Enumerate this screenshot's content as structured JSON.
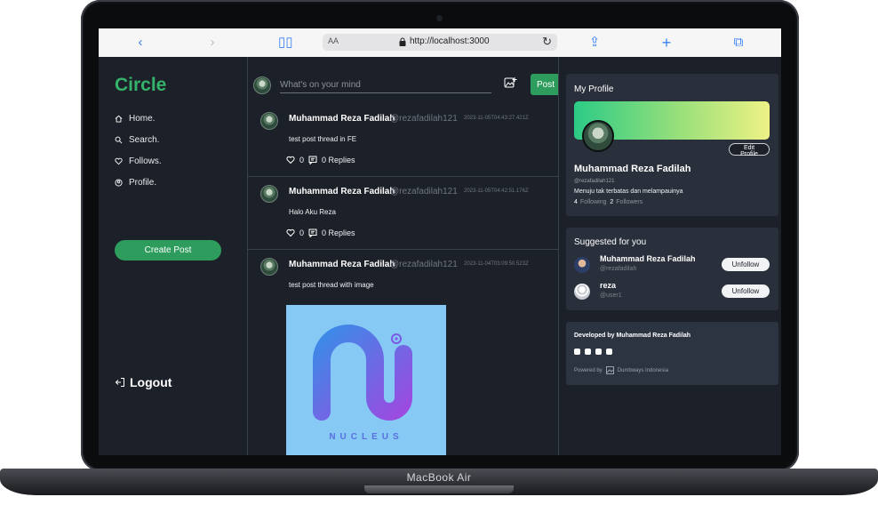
{
  "device": {
    "model": "MacBook Air"
  },
  "browser": {
    "url": "http://localhost:3000",
    "text_size": "AA"
  },
  "sidebar": {
    "logo": "Circle",
    "items": [
      {
        "label": "Home.",
        "icon": "home-icon"
      },
      {
        "label": "Search.",
        "icon": "search-icon"
      },
      {
        "label": "Follows.",
        "icon": "heart-icon"
      },
      {
        "label": "Profile.",
        "icon": "user-circle-icon"
      }
    ],
    "create_post": "Create Post",
    "logout": "Logout"
  },
  "composer": {
    "placeholder": "What's on your mind",
    "post_label": "Post"
  },
  "threads": [
    {
      "name": "Muhammad Reza Fadilah",
      "handle": "@rezafadilah121",
      "date": "2023-11-05T04:43:27.421Z",
      "text": "test post thread in FE",
      "likes": "0",
      "replies": "0 Replies"
    },
    {
      "name": "Muhammad Reza Fadilah",
      "handle": "@rezafadilah121",
      "date": "2023-11-05T04:42:51.176Z",
      "text": "Halo Aku Reza",
      "likes": "0",
      "replies": "0 Replies"
    },
    {
      "name": "Muhammad Reza Fadilah",
      "handle": "@rezafadilah121",
      "date": "2023-11-04T03:09:50.523Z",
      "text": "test post thread with image",
      "image_text": "NUCLEUS"
    }
  ],
  "profile": {
    "title": "My Profile",
    "edit_label": "Edit Profile",
    "name": "Muhammad Reza Fadilah",
    "handle": "@rezafadilah121",
    "bio": "Menuju tak terbatas dan melampauinya",
    "following": "4",
    "following_label": "Following",
    "followers": "2",
    "followers_label": "Followers"
  },
  "suggested": {
    "title": "Suggested for you",
    "users": [
      {
        "name": "Muhammad Reza Fadilah",
        "handle": "@rezafadilah",
        "button": "Unfollow"
      },
      {
        "name": "reza",
        "handle": "@user1",
        "button": "Unfollow"
      }
    ]
  },
  "footer": {
    "developed_by": "Developed by Muhammad Reza Fadilah",
    "powered_by": "Powered by",
    "company": "Dumbways Indonesia"
  },
  "colors": {
    "accent": "#2d9c5c",
    "background": "#1c2028",
    "card": "#2a303b"
  }
}
